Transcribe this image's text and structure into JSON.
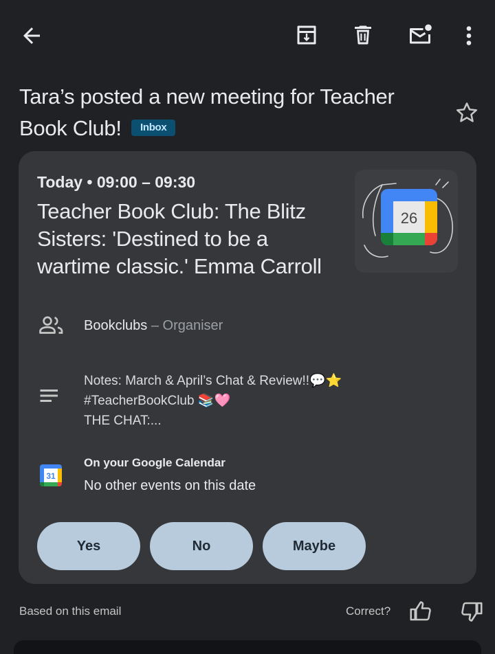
{
  "subject": {
    "title": "Tara’s posted a new meeting for Teacher Book Club!",
    "label": "Inbox"
  },
  "event": {
    "when": "Today • 09:00 – 09:30",
    "title": "Teacher Book Club: The Blitz Sisters: 'Destined to be a wartime classic.' Emma Carroll",
    "thumbnail_day": "26",
    "organiser_name": "Bookclubs",
    "organiser_role": "– Organiser",
    "notes": [
      "Notes: March & April’s Chat & Review!!💬⭐",
      "#TeacherBookClub 📚🩷",
      "THE CHAT:..."
    ],
    "calendar_heading": "On your Google Calendar",
    "calendar_status": "No other events on this date",
    "calendar_icon_day": "31"
  },
  "rsvp": {
    "yes": "Yes",
    "no": "No",
    "maybe": "Maybe"
  },
  "footer": {
    "based_on": "Based on this email",
    "correct": "Correct?"
  },
  "colors": {
    "background": "#202124",
    "card": "#35373a",
    "badge_bg": "#0b4f71",
    "badge_text": "#c2e7ff",
    "button_bg": "#b8cbdd"
  },
  "icons": [
    "back-arrow-icon",
    "archive-icon",
    "delete-icon",
    "mark-unread-icon",
    "more-vert-icon",
    "star-icon",
    "people-icon",
    "notes-icon",
    "google-calendar-icon",
    "thumbs-up-icon",
    "thumbs-down-icon"
  ]
}
